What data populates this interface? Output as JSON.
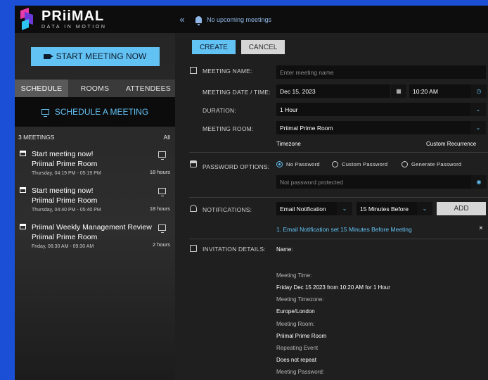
{
  "brand": {
    "name": "PRiiMAL",
    "tagline": "DATA IN MOTION"
  },
  "sidebar": {
    "start_button": "START MEETING NOW",
    "tabs": [
      {
        "label": "SCHEDULE",
        "active": true
      },
      {
        "label": "ROOMS",
        "active": false
      },
      {
        "label": "ATTENDEES",
        "active": false
      }
    ],
    "schedule_link": "SCHEDULE A MEETING",
    "meetings_count": "3 MEETINGS",
    "meetings_filter": "All",
    "meetings": [
      {
        "title": "Start meeting now!",
        "room": "Priimal Prime Room",
        "time": "Thursday, 04:19 PM - 05:19 PM",
        "in": "18 hours"
      },
      {
        "title": "Start meeting now!",
        "room": "Priimal Prime Room",
        "time": "Thursday, 04:40 PM - 05:40 PM",
        "in": "18 hours"
      },
      {
        "title": "Priimal Weekly Management Review",
        "room": "Priimal Prime Room",
        "time": "Friday, 08:30 AM - 09:30 AM",
        "in": "2 hours"
      }
    ]
  },
  "topbar": {
    "collapse": "«",
    "notice": "No upcoming meetings"
  },
  "form": {
    "create_label": "CREATE",
    "cancel_label": "CANCEL",
    "meeting_name": {
      "label": "MEETING NAME:",
      "placeholder": "Enter meeting name"
    },
    "date_time": {
      "label": "MEETING DATE / TIME:",
      "date": "Dec 15, 2023",
      "time": "10:20 AM"
    },
    "duration": {
      "label": "DURATION:",
      "value": "1 Hour"
    },
    "room": {
      "label": "MEETING ROOM:",
      "value": "Priimal Prime Room"
    },
    "timezone_label": "Timezone",
    "recurrence_label": "Custom Recurrence",
    "password": {
      "label": "PASSWORD OPTIONS:",
      "options": [
        "No Password",
        "Custom Password",
        "Generate Password"
      ],
      "selected": "No Password",
      "status": "Not password protected"
    },
    "notifications": {
      "label": "NOTIFICATIONS:",
      "type": "Email Notification",
      "when": "15 Minutes Before",
      "add_label": "ADD",
      "list": [
        "1. Email Notification set 15 Minutes Before Meeting"
      ],
      "remove_glyph": "×"
    },
    "invitation": {
      "label": "INVITATION DETAILS:",
      "name_label": "Name:",
      "meeting_time_label": "Meeting Time:",
      "meeting_time": "Friday Dec 15 2023  from  10:20 AM  for  1 Hour",
      "timezone_label": "Meeting Timezone:",
      "timezone": "Europe/London",
      "room_label": "Meeting Room:",
      "room": "Priimal Prime Room",
      "repeat_label": "Repeating Event",
      "repeat": "Does not repeat",
      "password_label": "Meeting Password:"
    }
  },
  "colors": {
    "accent": "#63c2f4",
    "frame_bg": "#1a4fd6",
    "panel_dark": "#0d0d0d"
  }
}
